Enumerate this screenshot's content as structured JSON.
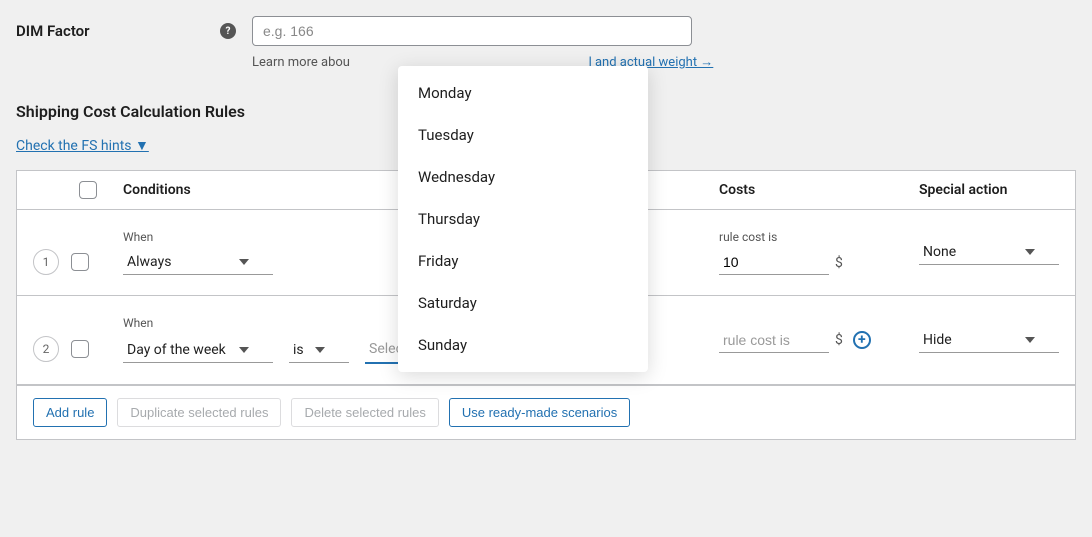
{
  "dim": {
    "label": "DIM Factor",
    "placeholder": "e.g. 166",
    "hint_prefix": "Learn more abou",
    "hint_link": "l and actual weight →"
  },
  "section_title": "Shipping Cost Calculation Rules",
  "hints_link": "Check the FS hints ▼",
  "table": {
    "col_conditions": "Conditions",
    "col_costs": "Costs",
    "col_special": "Special action"
  },
  "rules": [
    {
      "num": "1",
      "when_label": "When",
      "when_value": "Always",
      "cost_label": "rule cost is",
      "cost_value": "10",
      "currency": "$",
      "special": "None"
    },
    {
      "num": "2",
      "when_label": "When",
      "when_value": "Day of the week",
      "op": "is",
      "days_placeholder": "Select the days",
      "cost_label": "rule cost is",
      "cost_placeholder": "",
      "currency": "$",
      "special": "Hide"
    }
  ],
  "days_dropdown": [
    "Monday",
    "Tuesday",
    "Wednesday",
    "Thursday",
    "Friday",
    "Saturday",
    "Sunday"
  ],
  "toolbar": {
    "add": "Add rule",
    "duplicate": "Duplicate selected rules",
    "delete": "Delete selected rules",
    "scenarios": "Use ready-made scenarios"
  }
}
